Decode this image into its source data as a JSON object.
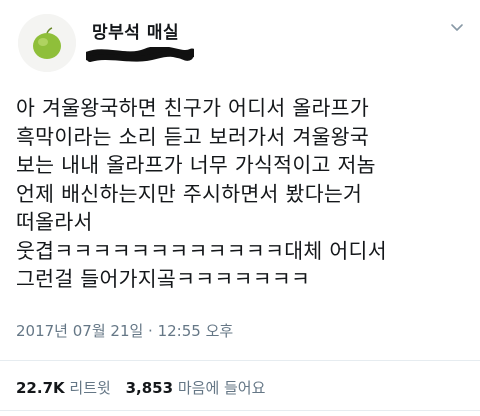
{
  "author": {
    "display_name": "망부석 매실",
    "avatar_icon": "green-plum-icon"
  },
  "tweet": {
    "lines": [
      "아 겨울왕국하면 친구가 어디서 올라프가",
      "흑막이라는 소리 듣고 보러가서 겨울왕국",
      "보는 내내 올라프가 너무 가식적이고 저놈",
      "언제 배신하는지만 주시하면서 봤다는거",
      "떠올라서",
      "웃겹ㅋㅋㅋㅋㅋㅋㅋㅋㅋㅋㅋㅋ대체 어디서",
      "그런걸 들어가지곸ㅋㅋㅋㅋㅋㅋㅋ"
    ],
    "timestamp": "2017년 07월 21일 · 12:55 오후"
  },
  "stats": {
    "retweets_count": "22.7K",
    "retweets_label": "리트윗",
    "likes_count": "3,853",
    "likes_label": "마음에 들어요"
  },
  "colors": {
    "text": "#14171a",
    "secondary": "#657786",
    "divider": "#e6ecf0"
  }
}
